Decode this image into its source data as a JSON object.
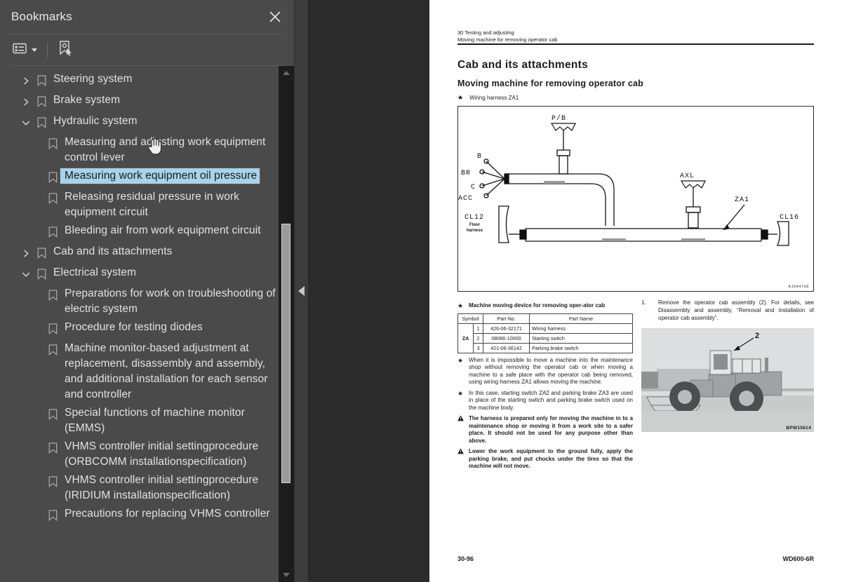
{
  "panel": {
    "title": "Bookmarks",
    "close_icon": "close-icon",
    "toolbar": {
      "options_icon": "list-options-icon",
      "new_bookmark_icon": "new-bookmark-icon"
    }
  },
  "bookmarks": [
    {
      "label": "Steering system",
      "level": 0,
      "state": "collapsed",
      "selected": false
    },
    {
      "label": "Brake system",
      "level": 0,
      "state": "collapsed",
      "selected": false
    },
    {
      "label": "Hydraulic system",
      "level": 0,
      "state": "expanded",
      "selected": false
    },
    {
      "label": "Measuring and adjusting work equipment control lever",
      "level": 1,
      "state": "leaf",
      "selected": false
    },
    {
      "label": "Measuring work equipment oil pressure",
      "level": 1,
      "state": "leaf",
      "selected": true
    },
    {
      "label": "Releasing residual pressure in work equipment circuit",
      "level": 1,
      "state": "leaf",
      "selected": false
    },
    {
      "label": "Bleeding air from work equipment circuit",
      "level": 1,
      "state": "leaf",
      "selected": false
    },
    {
      "label": "Cab and its attachments",
      "level": 0,
      "state": "collapsed",
      "selected": false
    },
    {
      "label": "Electrical system",
      "level": 0,
      "state": "expanded",
      "selected": false
    },
    {
      "label": "Preparations for work on troubleshooting of electric system",
      "level": 1,
      "state": "leaf",
      "selected": false
    },
    {
      "label": "Procedure for testing diodes",
      "level": 1,
      "state": "leaf",
      "selected": false
    },
    {
      "label": "Machine monitor-based adjustment at replacement, disassembly and assembly, and additional installation for each sensor and controller",
      "level": 1,
      "state": "leaf",
      "selected": false
    },
    {
      "label": "Special functions of machine monitor (EMMS)",
      "level": 1,
      "state": "leaf",
      "selected": false
    },
    {
      "label": "VHMS controller initial settingprocedure (ORBCOMM installationspecification)",
      "level": 1,
      "state": "leaf",
      "selected": false
    },
    {
      "label": "VHMS controller initial settingprocedure (IRIDIUM installationspecification)",
      "level": 1,
      "state": "leaf",
      "selected": false
    },
    {
      "label": "Precautions for replacing VHMS controller",
      "level": 1,
      "state": "leaf",
      "selected": false
    }
  ],
  "document": {
    "header_line1": "30 Testing and adjusting",
    "header_line2": "Moving machine for removing operator cab",
    "heading1": "Cab and its attachments",
    "heading2": "Moving machine for removing operator cab",
    "star_note": "Wiring harness ZA1",
    "figure": {
      "id": "9JS04705",
      "labels": {
        "pb": "P/B",
        "b": "B",
        "br": "BR",
        "c": "C",
        "acc": "ACC",
        "axl": "AXL",
        "za1": "ZA1",
        "cl12": "CL12",
        "cl12_sub1": "Floor",
        "cl12_sub2": "harness",
        "cl16": "CL16"
      }
    },
    "left_column": {
      "device_note": "Machine moving device for removing oper-ator cab",
      "table": {
        "headers": [
          "Symbol",
          "Part No.",
          "Part Name"
        ],
        "symbol": "ZA",
        "rows": [
          {
            "idx": "1",
            "part_no": "426-06-32171",
            "part_name": "Wiring harness"
          },
          {
            "idx": "2",
            "part_no": "08086-10000",
            "part_name": "Starting switch"
          },
          {
            "idx": "3",
            "part_no": "421-06-36142",
            "part_name": "Parking brake switch"
          }
        ]
      },
      "notes": [
        {
          "marker": "star",
          "text": "When it is impossible to move a machine into the maintenance shop without removing the operator cab or when moving a machine to a safe place with the operator cab being removed, using wiring harness ZA1 allows moving the machine."
        },
        {
          "marker": "star",
          "text": "In this case, starting switch ZA2 and parking brake ZA3 are used in place of the starting switch and parking brake switch used on the machine body."
        },
        {
          "marker": "warning",
          "text": "The harness is prepared only for moving the machine in to a maintenance shop or moving it from a work site to a safer place. It should not be used for any purpose other than above."
        },
        {
          "marker": "warning",
          "text": "Lower the work equipment to the ground fully, apply the parking brake, and put chocks under the tires so that the machine will not move."
        }
      ]
    },
    "right_column": {
      "step_number": "1.",
      "step_text": "Remove the operator cab assembly (2). For details, see Disassembly and assembly, “Removal and installation of operator cab assembly”.",
      "photo_callout": "2",
      "photo_id": "BPW15614"
    },
    "footer_left": "30-96",
    "footer_right": "WD600-6R"
  },
  "colors": {
    "panel_bg": "#4a4a4a",
    "viewer_bg": "#2b2b2b",
    "selection": "#a8d3ea",
    "page_bg": "#ffffff",
    "text": "#e2e2e2"
  }
}
